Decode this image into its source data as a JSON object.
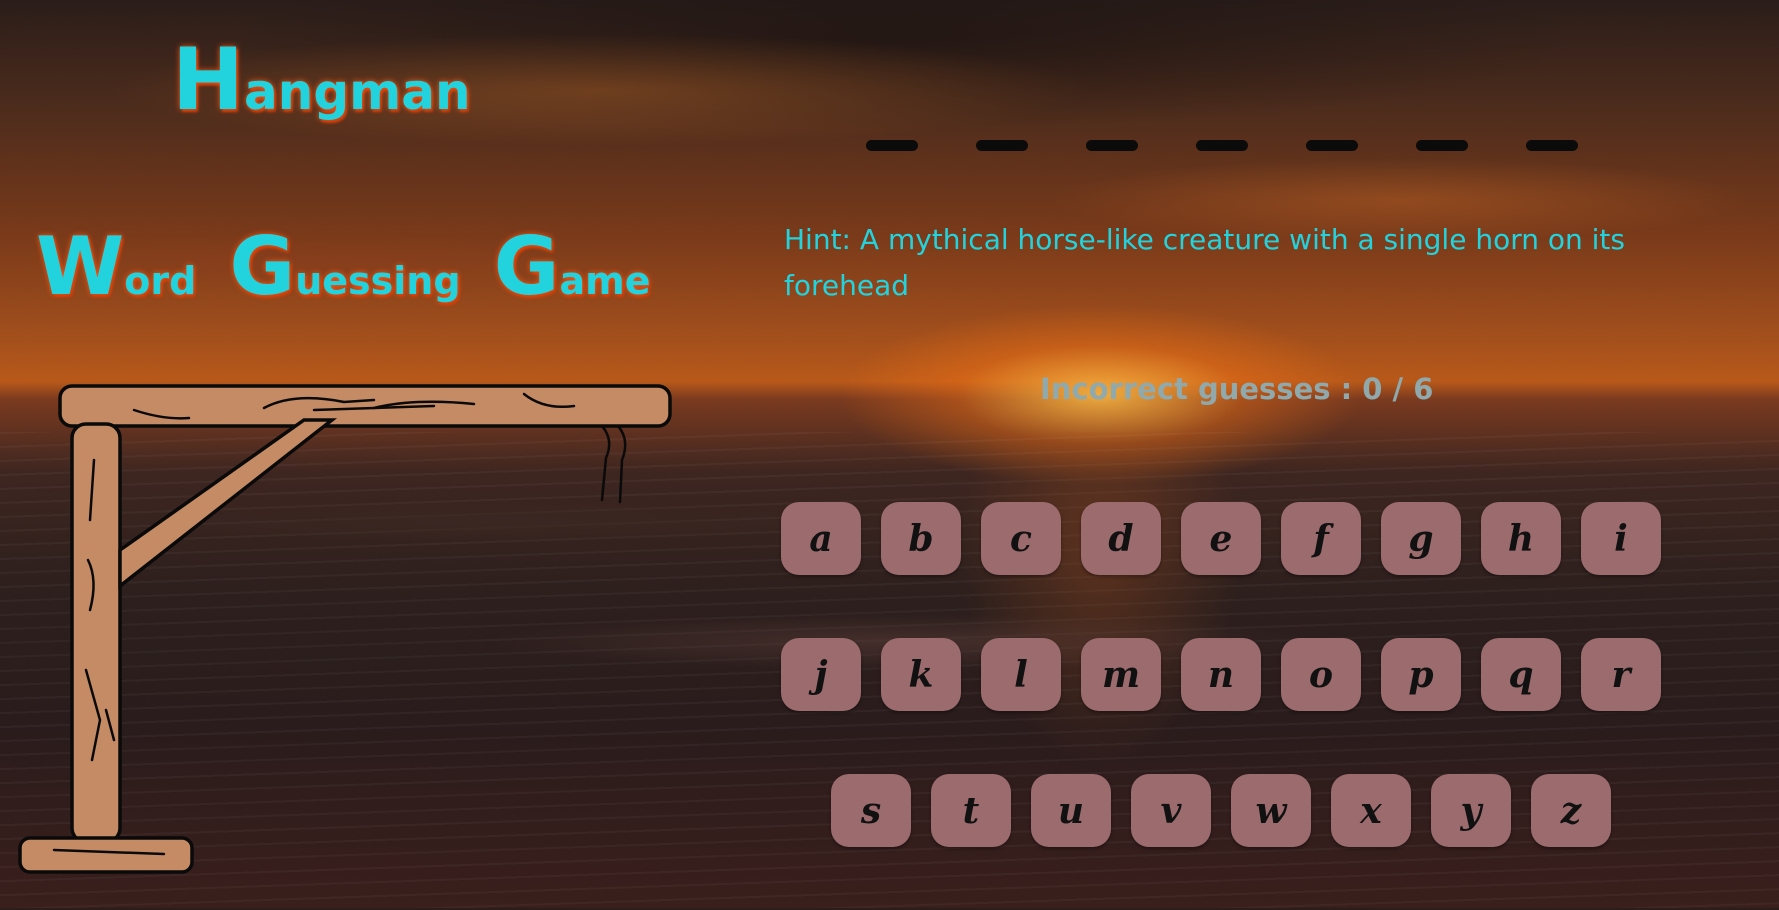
{
  "title": {
    "main_cap": "H",
    "main_rest": "angman",
    "sub": [
      {
        "cap": "W",
        "rest": "ord"
      },
      {
        "cap": "G",
        "rest": "uessing"
      },
      {
        "cap": "G",
        "rest": "ame"
      }
    ]
  },
  "word": {
    "letters_total": 7,
    "revealed": [
      "",
      "",
      "",
      "",
      "",
      "",
      ""
    ]
  },
  "hint": "Hint: A mythical horse-like creature with a single horn on its forehead",
  "incorrect": {
    "text": "Incorrect guesses : 0 / 6",
    "count": 0,
    "max": 6
  },
  "keyboard": {
    "rows": [
      [
        "a",
        "b",
        "c",
        "d",
        "e",
        "f",
        "g",
        "h",
        "i"
      ],
      [
        "j",
        "k",
        "l",
        "m",
        "n",
        "o",
        "p",
        "q",
        "r"
      ],
      [
        "s",
        "t",
        "u",
        "v",
        "w",
        "x",
        "y",
        "z"
      ]
    ]
  },
  "colors": {
    "accent": "#22d3de",
    "key_bg": "#9b6b6e",
    "wood": "#c58b65"
  },
  "icons": {
    "gallows": "gallows-icon"
  }
}
